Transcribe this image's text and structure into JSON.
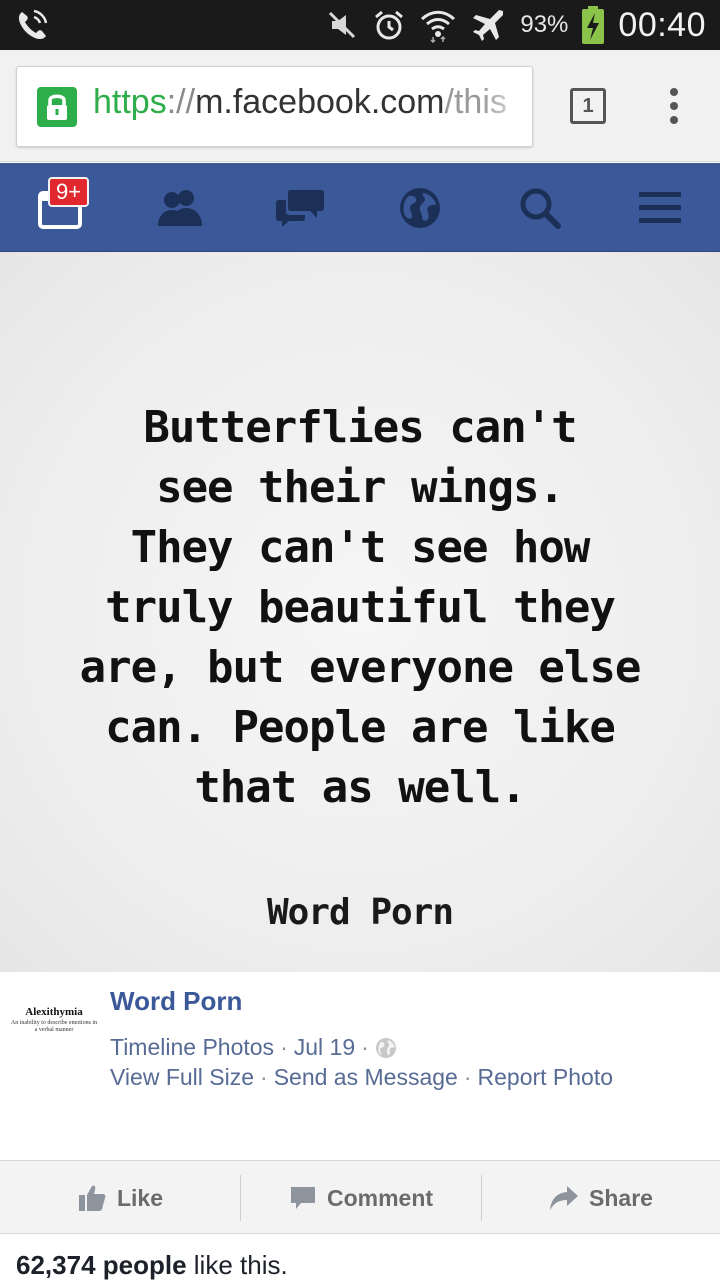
{
  "status_bar": {
    "battery_percent": "93%",
    "time": "00:40",
    "icons": [
      "phone-call-icon",
      "mute-icon",
      "alarm-icon",
      "wifi-icon",
      "airplane-mode-icon",
      "battery-charging-icon"
    ]
  },
  "browser": {
    "url_scheme": "https",
    "url_sep": "://",
    "url_host": "m.facebook.com",
    "url_path": "/this",
    "tab_count": "1"
  },
  "fb_nav": {
    "notification_badge": "9+",
    "brand_color": "#3b5998"
  },
  "photo": {
    "quote_lines": [
      "Butterflies can't",
      "see their wings.",
      "They can't see how",
      "truly beautiful they",
      "are, but everyone else",
      "can. People are like",
      "that as well."
    ],
    "source": "Word Porn"
  },
  "post": {
    "avatar_title": "Alexithymia",
    "avatar_subtitle": "An inability to describe emotions in a verbal manner",
    "page_name": "Word Porn",
    "album": "Timeline Photos",
    "date": "Jul 19",
    "separator": "·",
    "link_full_size": "View Full Size",
    "link_send": "Send as Message",
    "link_report": "Report Photo"
  },
  "actions": {
    "like": "Like",
    "comment": "Comment",
    "share": "Share"
  },
  "likes": {
    "count": "62,374 people",
    "suffix": "like this."
  }
}
